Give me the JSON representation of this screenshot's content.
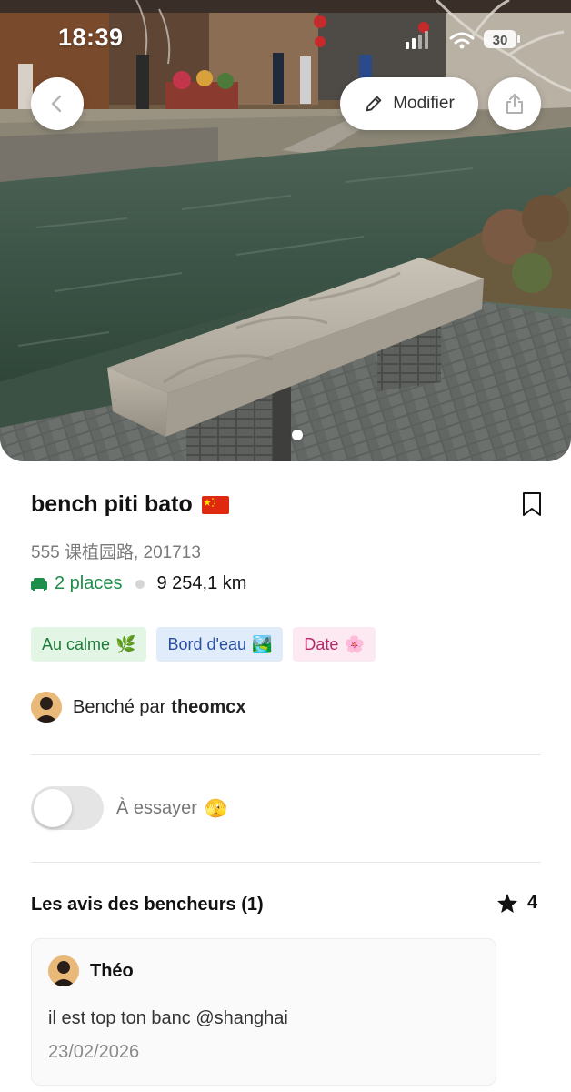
{
  "status_bar": {
    "time": "18:39",
    "battery": "30"
  },
  "header": {
    "modify_label": "Modifier",
    "icons": [
      "chevron-left-icon",
      "pencil-icon",
      "share-icon"
    ]
  },
  "bench": {
    "name": "bench piti bato",
    "flag": "china-flag",
    "address": "555 课植园路, 201713",
    "places": "2 places",
    "distance": "9 254,1 km",
    "tags": [
      {
        "label": "Au calme",
        "emoji": "🌿",
        "color": "#1f7a3a"
      },
      {
        "label": "Bord d'eau",
        "emoji": "🏞️",
        "color": "#2b4fa0"
      },
      {
        "label": "Date",
        "emoji": "🌸",
        "color": "#b42a6a"
      }
    ],
    "benched_by_prefix": "Benché par",
    "benched_by_user": "theomcx"
  },
  "try_toggle": {
    "label": "À essayer",
    "emoji": "🫣",
    "on": false
  },
  "reviews": {
    "title": "Les avis des bencheurs (1)",
    "rating": "4",
    "items": [
      {
        "author": "Théo",
        "text": "il est top ton banc @shanghai",
        "date": "23/02/2026"
      }
    ]
  },
  "colors": {
    "accent_green": "#1e8e4a",
    "text_dark": "#111111",
    "muted": "#7a7a7a"
  }
}
